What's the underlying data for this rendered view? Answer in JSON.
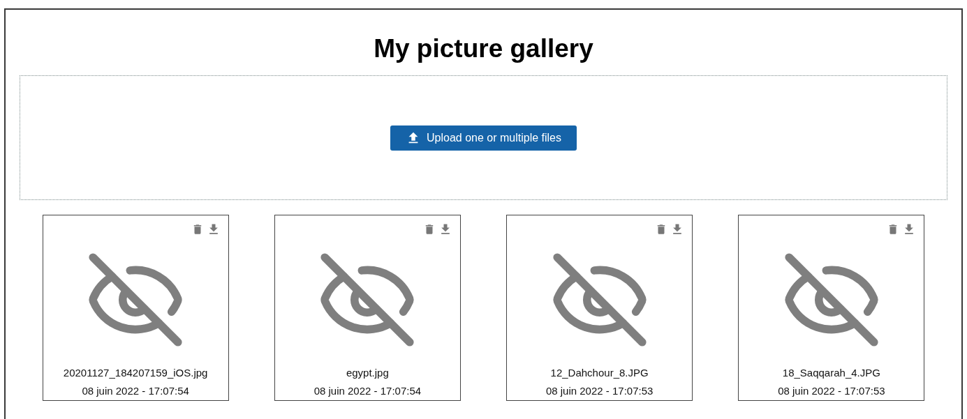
{
  "title": "My picture gallery",
  "upload_button": {
    "label": "Upload one or multiple files"
  },
  "pictures": [
    {
      "name": "20201127_184207159_iOS.jpg",
      "date": "08 juin 2022 - 17:07:54"
    },
    {
      "name": "egypt.jpg",
      "date": "08 juin 2022 - 17:07:54"
    },
    {
      "name": "12_Dahchour_8.JPG",
      "date": "08 juin 2022 - 17:07:53"
    },
    {
      "name": "18_Saqqarah_4.JPG",
      "date": "08 juin 2022 - 17:07:53"
    }
  ]
}
